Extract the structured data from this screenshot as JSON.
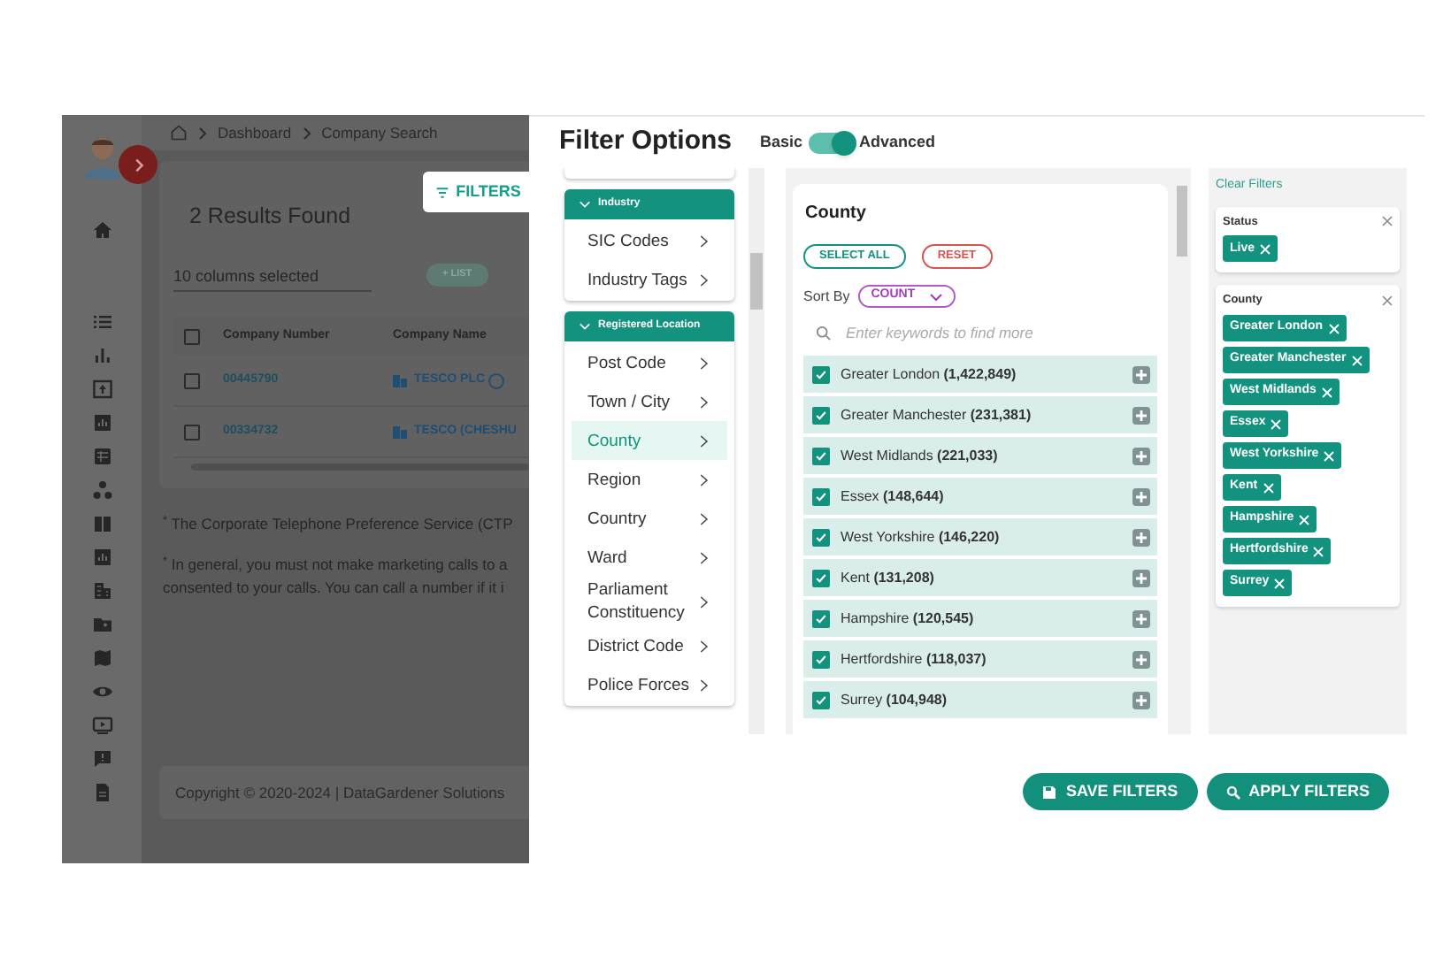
{
  "background_app": {
    "breadcrumb": [
      "Dashboard",
      "Company Search"
    ],
    "results_title": "2 Results Found",
    "filters_button": "FILTERS",
    "columns_select": "10 columns selected",
    "list_button": "+ LIST",
    "table": {
      "all_selected": false,
      "columns": [
        "Company Number",
        "Company Name"
      ],
      "rows": [
        {
          "number": "00445790",
          "name": "TESCO PLC",
          "selected": false
        },
        {
          "number": "00334732",
          "name": "TESCO (CHESHU",
          "selected": false
        }
      ]
    },
    "notes": [
      {
        "lines": [
          "$^{*}$ The Corporate Telephone Preference Service (CTP"
        ]
      },
      {
        "lines": [
          "$^{*}$ In general, you must not make marketing calls to a",
          "consented to your calls. You can call a number if it i"
        ]
      }
    ],
    "copyright": "Copyright © 2020-2024 | DataGardener Solutions"
  },
  "filter_panel": {
    "title": "Filter Options",
    "mode_toggle": {
      "left_label": "Basic",
      "right_label": "Advanced",
      "on": true
    },
    "categories": [
      {
        "title": "Industry",
        "expanded": true,
        "items": [
          {
            "label": "SIC Codes",
            "selected": false
          },
          {
            "label": "Industry Tags",
            "selected": false
          }
        ]
      },
      {
        "title": "Registered Location",
        "expanded": true,
        "items": [
          {
            "label": "Post Code",
            "selected": false
          },
          {
            "label": "Town / City",
            "selected": false
          },
          {
            "label": "County",
            "selected": true
          },
          {
            "label": "Region",
            "selected": false
          },
          {
            "label": "Country",
            "selected": false
          },
          {
            "label": "Ward",
            "selected": false
          },
          {
            "label": "Parliament Constituency",
            "selected": false
          },
          {
            "label": "District Code",
            "selected": false
          },
          {
            "label": "Police Forces",
            "selected": false
          }
        ]
      }
    ],
    "detail": {
      "title": "County",
      "select_all": "SELECT ALL",
      "reset": "RESET",
      "sort_label": "Sort By",
      "sort_value": "COUNT",
      "search_placeholder": "Enter keywords to find more",
      "options": [
        {
          "name": "Greater London",
          "count": "(1,422,849)",
          "checked": true
        },
        {
          "name": "Greater Manchester",
          "count": "(231,381)",
          "checked": true
        },
        {
          "name": "West Midlands",
          "count": "(221,033)",
          "checked": true
        },
        {
          "name": "Essex",
          "count": "(148,644)",
          "checked": true
        },
        {
          "name": "West Yorkshire",
          "count": "(146,220)",
          "checked": true
        },
        {
          "name": "Kent",
          "count": "(131,208)",
          "checked": true
        },
        {
          "name": "Hampshire",
          "count": "(120,545)",
          "checked": true
        },
        {
          "name": "Hertfordshire",
          "count": "(118,037)",
          "checked": true
        },
        {
          "name": "Surrey",
          "count": "(104,948)",
          "checked": true
        }
      ]
    },
    "applied": {
      "clear_label": "Clear Filters",
      "groups": [
        {
          "title": "Status",
          "chips": [
            "Live"
          ]
        },
        {
          "title": "County",
          "chips": [
            "Greater London",
            "Greater Manchester",
            "West Midlands",
            "Essex",
            "West Yorkshire",
            "Kent",
            "Hampshire",
            "Hertfordshire",
            "Surrey"
          ]
        }
      ]
    },
    "save_button": "SAVE FILTERS",
    "apply_button": "APPLY FILTERS"
  }
}
